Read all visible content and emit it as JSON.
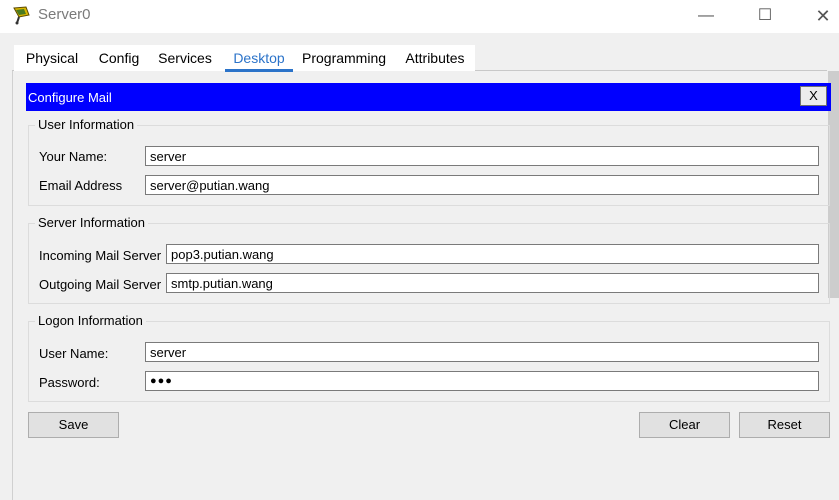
{
  "window": {
    "title": "Server0",
    "minimize": "—",
    "maximize": "☐",
    "close": "✕"
  },
  "tabs": [
    {
      "label": "Physical"
    },
    {
      "label": "Config"
    },
    {
      "label": "Services"
    },
    {
      "label": "Desktop",
      "active": true
    },
    {
      "label": "Programming"
    },
    {
      "label": "Attributes"
    }
  ],
  "dialog": {
    "title": "Configure Mail",
    "close_label": "X"
  },
  "user_info": {
    "legend": "User Information",
    "name_label": "Your Name:",
    "name_value": "server",
    "email_label": "Email Address",
    "email_value": "server@putian.wang"
  },
  "server_info": {
    "legend": "Server Information",
    "incoming_label": "Incoming Mail Server",
    "incoming_value": "pop3.putian.wang",
    "outgoing_label": "Outgoing Mail Server",
    "outgoing_value": "smtp.putian.wang"
  },
  "logon_info": {
    "legend": "Logon Information",
    "username_label": "User Name:",
    "username_value": "server",
    "password_label": "Password:",
    "password_value": "●●●"
  },
  "buttons": {
    "save": "Save",
    "clear": "Clear",
    "reset": "Reset"
  },
  "colors": {
    "dialog_header": "#0000ff",
    "active_tab": "#2b73c9"
  }
}
